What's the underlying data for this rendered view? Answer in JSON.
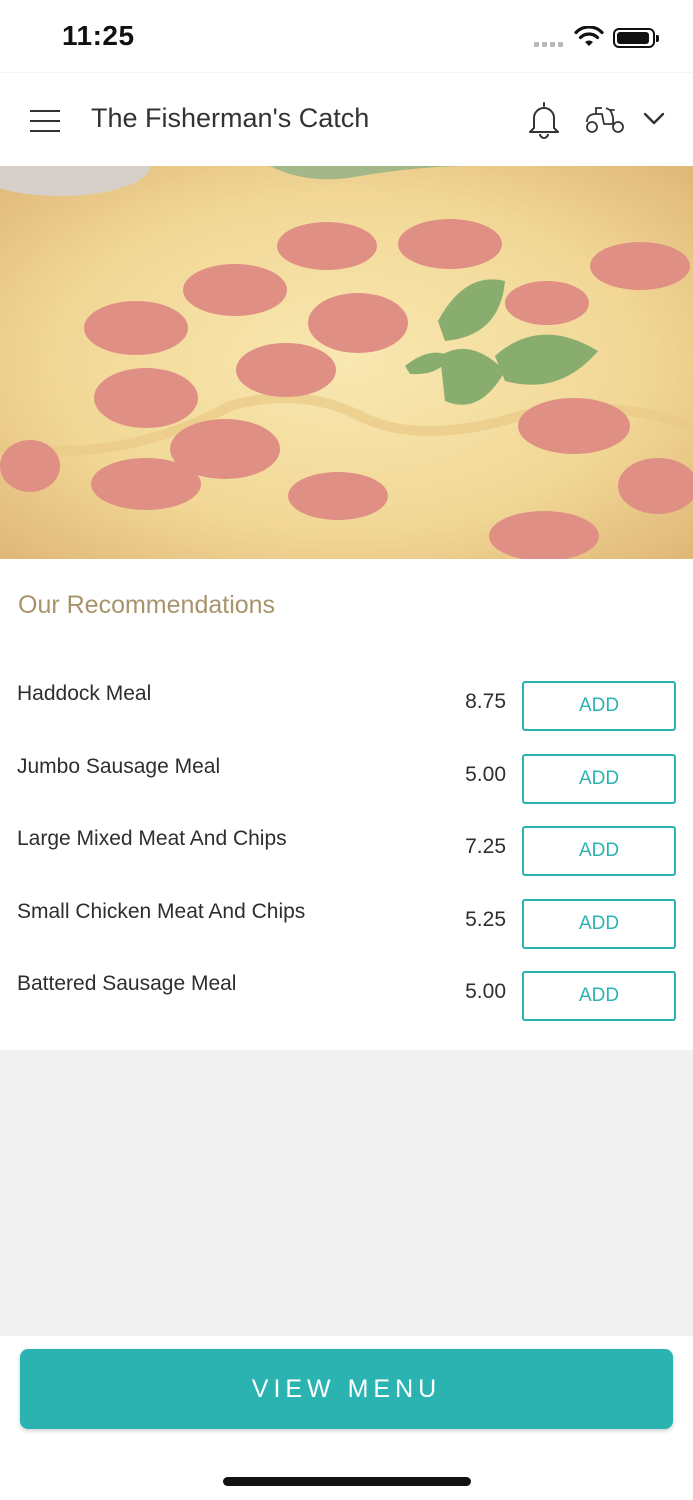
{
  "status_bar": {
    "time": "11:25"
  },
  "header": {
    "title": "The Fisherman's Catch",
    "icons": [
      "menu-icon",
      "bell-icon",
      "scooter-icon",
      "chevron-down-icon"
    ]
  },
  "hero": {
    "image": "pepperoni-pizza"
  },
  "recommendations": {
    "title": "Our Recommendations",
    "items": [
      {
        "name": "Haddock Meal",
        "price": "8.75",
        "button": "ADD"
      },
      {
        "name": "Jumbo Sausage Meal",
        "price": "5.00",
        "button": "ADD"
      },
      {
        "name": "Large Mixed Meat And Chips",
        "price": "7.25",
        "button": "ADD"
      },
      {
        "name": "Small Chicken Meat And Chips",
        "price": "5.25",
        "button": "ADD"
      },
      {
        "name": "Battered Sausage Meal",
        "price": "5.00",
        "button": "ADD"
      }
    ]
  },
  "footer": {
    "view_menu_label": "VIEW MENU"
  },
  "colors": {
    "accent": "#2bb3b1",
    "section_title": "#a8946a",
    "background_grey": "#f1f1f1"
  }
}
